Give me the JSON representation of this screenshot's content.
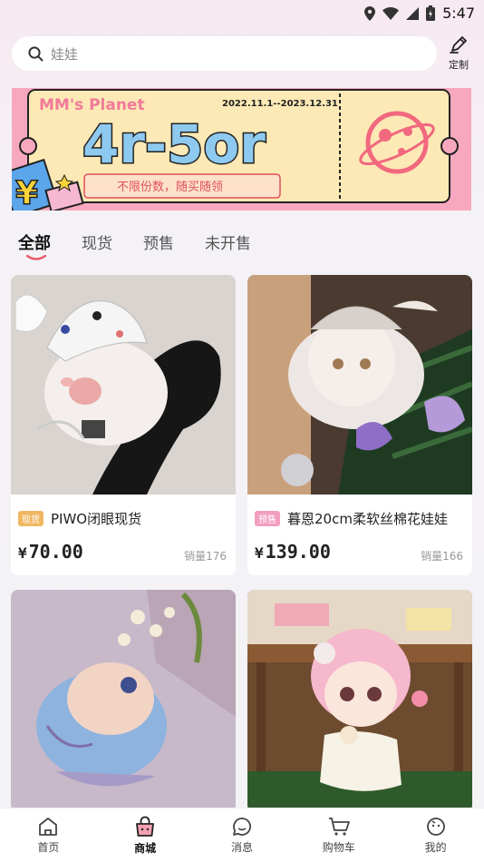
{
  "status": {
    "time": "5:47"
  },
  "search": {
    "placeholder": "娃娃",
    "custom_label": "定制"
  },
  "banner": {
    "headline_small": "MM's Planet",
    "date_range": "2022.11.1--2023.12.31",
    "big_text": "4r-5or",
    "subtitle": "不限份数，随买随领",
    "yen": "¥"
  },
  "tabs": [
    {
      "label": "全部",
      "active": true
    },
    {
      "label": "现货",
      "active": false
    },
    {
      "label": "预售",
      "active": false
    },
    {
      "label": "未开售",
      "active": false
    }
  ],
  "products": [
    {
      "tag": "现货",
      "tag_color": "#f0b763",
      "title": "PIWO闭眼现货",
      "currency": "¥",
      "price": "70.00",
      "sales": "销量176"
    },
    {
      "tag": "预售",
      "tag_color": "#f39ec0",
      "title": "暮恩20cm柔软丝棉花娃娃",
      "currency": "¥",
      "price": "139.00",
      "sales": "销量166"
    },
    {
      "tag": "",
      "title": "",
      "currency": "",
      "price": "",
      "sales": ""
    },
    {
      "tag": "",
      "title": "",
      "currency": "",
      "price": "",
      "sales": ""
    }
  ],
  "bottom_nav": [
    {
      "label": "首页",
      "icon": "home-icon",
      "active": false
    },
    {
      "label": "商城",
      "icon": "shop-bag-icon",
      "active": true
    },
    {
      "label": "消息",
      "icon": "chat-icon",
      "active": false
    },
    {
      "label": "购物车",
      "icon": "cart-icon",
      "active": false
    },
    {
      "label": "我的",
      "icon": "profile-icon",
      "active": false
    }
  ],
  "colors": {
    "accent": "#e85a6a",
    "banner_bg": "#fde9b5",
    "banner_pink": "#f7a8bf"
  }
}
